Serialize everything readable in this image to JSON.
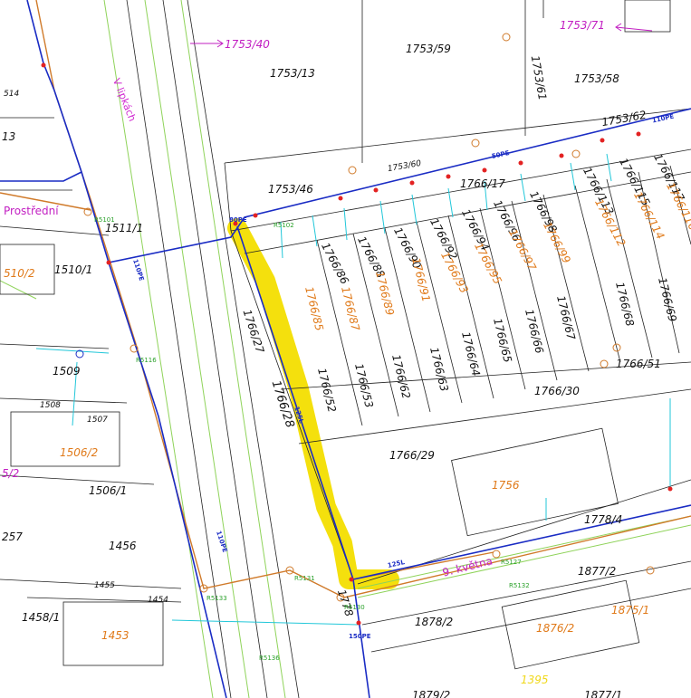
{
  "map": {
    "colors": {
      "parcel_line": "#222222",
      "road_line": "#8fd35a",
      "water_pipe": "#1a2cc4",
      "sewer_pipe": "#d07a2a",
      "highlight": "#f3de00",
      "cyan": "#22c7d9",
      "magenta": "#c21fc2",
      "red_marker": "#e32222"
    },
    "streets": {
      "v_lipkach": "V lipkách",
      "prostredni": "Prostřední",
      "9_kvetna": "9. května"
    },
    "parcels_black": {
      "p1753_13": "1753/13",
      "p1753_59": "1753/59",
      "p1753_58": "1753/58",
      "p1753_61": "1753/61",
      "p1753_62": "1753/62",
      "p1753_60": "1753/60",
      "p1753_46": "1753/46",
      "p1766_17": "1766/17",
      "p1511_1": "1511/1",
      "p1510_1": "1510/1",
      "p1509": "1509",
      "p1508": "1508",
      "p1507": "1507",
      "p1506_1": "1506/1",
      "p1456": "1456",
      "p1455": "1455",
      "p1454": "1454",
      "p1458_1": "1458/1",
      "p1766_27": "1766/27",
      "p1766_28": "1766/28",
      "p1766_52": "1766/52",
      "p1766_53": "1766/53",
      "p1766_62": "1766/62",
      "p1766_63": "1766/63",
      "p1766_64": "1766/64",
      "p1766_65": "1766/65",
      "p1766_66": "1766/66",
      "p1766_67": "1766/67",
      "p1766_68": "1766/68",
      "p1766_69": "1766/69",
      "p1766_51": "1766/51",
      "p1766_30": "1766/30",
      "p1766_29": "1766/29",
      "p1766_86": "1766/86",
      "p1766_88": "1766/88",
      "p1766_90": "1766/90",
      "p1766_92": "1766/92",
      "p1766_94": "1766/94",
      "p1766_96": "1766/96",
      "p1766_98": "1766/98",
      "p1766_113": "1766/113",
      "p1766_115": "1766/115",
      "p1766_117": "1766/117",
      "p1778_4": "1778/4",
      "p1877_2": "1877/2",
      "p1878_2": "1878/2",
      "p1778": "1778",
      "p1879": "1879/2",
      "p1877_1": "1877/1",
      "p514": "514",
      "p13": "13",
      "p257": "257"
    },
    "parcels_orange": {
      "p1766_85": "1766/85",
      "p1766_87": "1766/87",
      "p1766_89": "1766/89",
      "p1766_91": "1766/91",
      "p1766_93": "1766/93",
      "p1766_95": "1766/95",
      "p1766_97": "1766/97",
      "p1766_99": "1766/99",
      "p1766_112": "1766/112",
      "p1766_114": "1766/114",
      "p1766_116": "1766/116",
      "p1510_2": "510/2",
      "p1506_2": "1506/2",
      "p1453": "1453",
      "p1756": "1756",
      "p1876_2": "1876/2",
      "p1875_1": "1875/1"
    },
    "parcels_magenta": {
      "p1753_40": "1753/40",
      "p1753_71": "1753/71",
      "p5_2": "5/2"
    },
    "other_labels": {
      "p1395": "1395"
    },
    "pipe_labels": {
      "w1": "50PE",
      "w2": "80PE",
      "w3": "110PE",
      "w4": "110PE",
      "w5": "125L",
      "w6": "150PE",
      "w7": "125L",
      "w8": "110PE"
    },
    "markers": {
      "m1": "R5101",
      "m2": "R5102",
      "m3": "R5116",
      "m4": "R5133",
      "m5": "R5131",
      "m6": "R5130",
      "m7": "R5127",
      "m8": "R5132",
      "m9": "R5136"
    }
  }
}
